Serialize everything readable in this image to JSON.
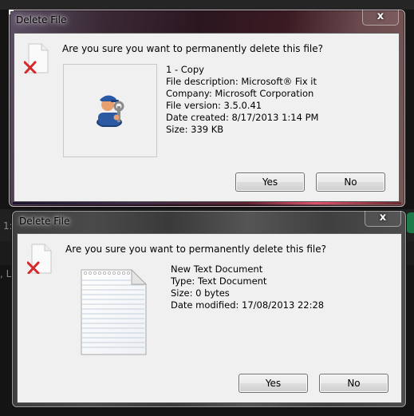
{
  "background": {
    "left_text_1": "1:",
    "left_text_2": ", LL"
  },
  "dialogs": [
    {
      "title": "Delete File",
      "close_label": "x",
      "question": "Are you sure you want to permanently delete this file?",
      "preview_icon": "technician-wrench-icon",
      "file_info": [
        "1 - Copy",
        "File description: Microsoft® Fix it",
        "Company: Microsoft Corporation",
        "File version: 3.5.0.41",
        "Date created: 8/17/2013 1:14 PM",
        "Size: 339 KB"
      ],
      "buttons": {
        "yes": "Yes",
        "no": "No"
      },
      "accent": "#e0506a"
    },
    {
      "title": "Delete File",
      "close_label": "x",
      "question": "Are you sure you want to permanently delete this file?",
      "preview_icon": "text-document-icon",
      "file_info": [
        "New Text Document",
        "Type: Text Document",
        "Size: 0 bytes",
        "Date modified: 17/08/2013 22:28"
      ],
      "buttons": {
        "yes": "Yes",
        "no": "No"
      }
    }
  ]
}
